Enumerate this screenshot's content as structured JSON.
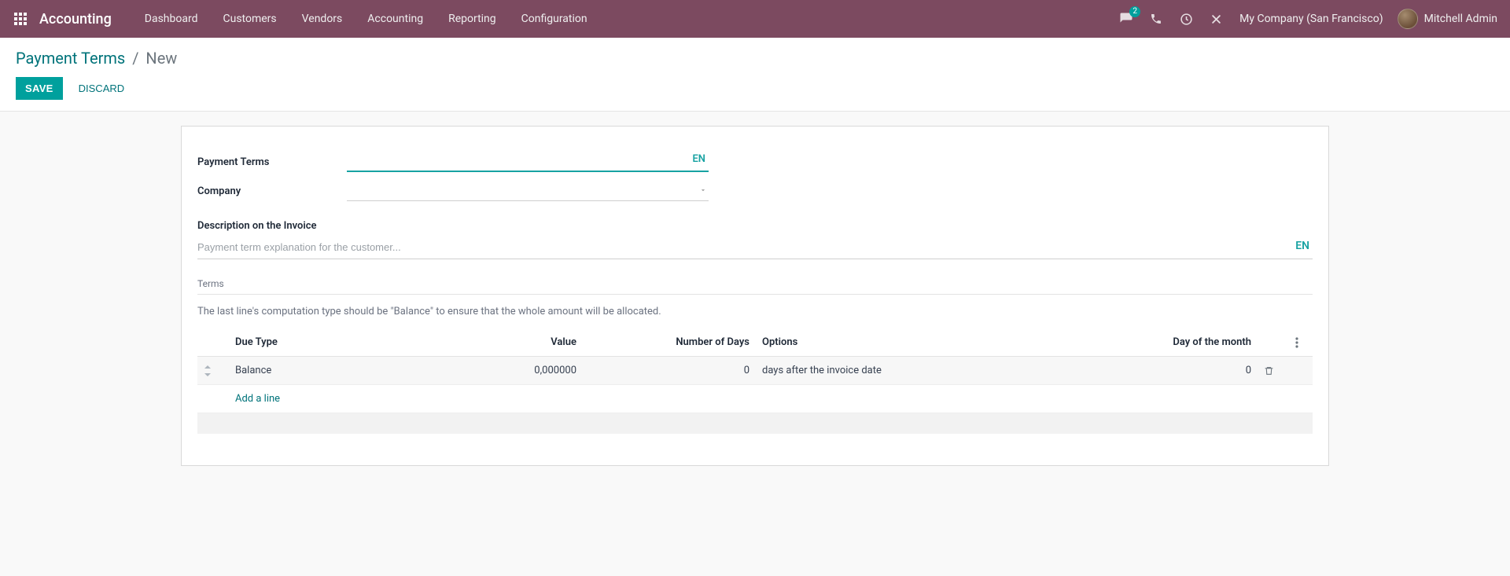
{
  "navbar": {
    "appName": "Accounting",
    "menu": [
      "Dashboard",
      "Customers",
      "Vendors",
      "Accounting",
      "Reporting",
      "Configuration"
    ],
    "messagesBadge": "2",
    "company": "My Company (San Francisco)",
    "user": "Mitchell Admin"
  },
  "breadcrumb": {
    "root": "Payment Terms",
    "leaf": "New",
    "sep": "/"
  },
  "buttons": {
    "save": "SAVE",
    "discard": "DISCARD"
  },
  "form": {
    "labels": {
      "paymentTerms": "Payment Terms",
      "company": "Company",
      "descOnInvoice": "Description on the Invoice"
    },
    "paymentTermsValue": "",
    "langTag": "EN",
    "companyValue": "",
    "descPlaceholder": "Payment term explanation for the customer...",
    "descValue": ""
  },
  "terms": {
    "sectionTitle": "Terms",
    "note": "The last line's computation type should be \"Balance\" to ensure that the whole amount will be allocated.",
    "columns": {
      "dueType": "Due Type",
      "value": "Value",
      "numberOfDays": "Number of Days",
      "options": "Options",
      "dayOfMonth": "Day of the month"
    },
    "rows": [
      {
        "dueType": "Balance",
        "value": "0,000000",
        "numberOfDays": "0",
        "options": "days after the invoice date",
        "dayOfMonth": "0"
      }
    ],
    "addLine": "Add a line"
  }
}
